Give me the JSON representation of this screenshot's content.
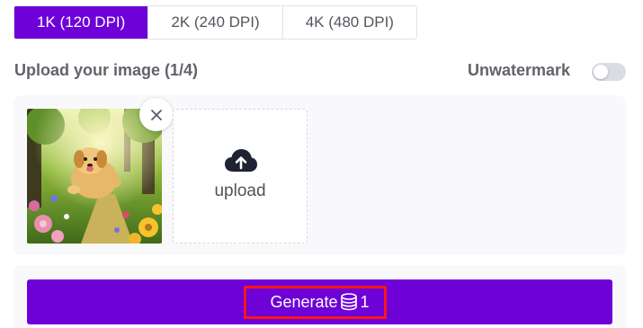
{
  "resolution_options": [
    {
      "label": "1K (120 DPI)",
      "active": true
    },
    {
      "label": "2K (240 DPI)",
      "active": false
    },
    {
      "label": "4K (480 DPI)",
      "active": false
    }
  ],
  "upload": {
    "heading": "Upload your image (1/4)",
    "upload_label": "upload"
  },
  "unwatermark": {
    "label": "Unwatermark",
    "enabled": false
  },
  "generate": {
    "label": "Generate",
    "cost": "1"
  },
  "icons": {
    "remove": "close-icon",
    "upload": "cloud-upload-icon",
    "credits": "coin-stack-icon"
  },
  "colors": {
    "accent": "#6e00d8",
    "highlight": "#ff1616",
    "panel": "#f9f9fb"
  }
}
